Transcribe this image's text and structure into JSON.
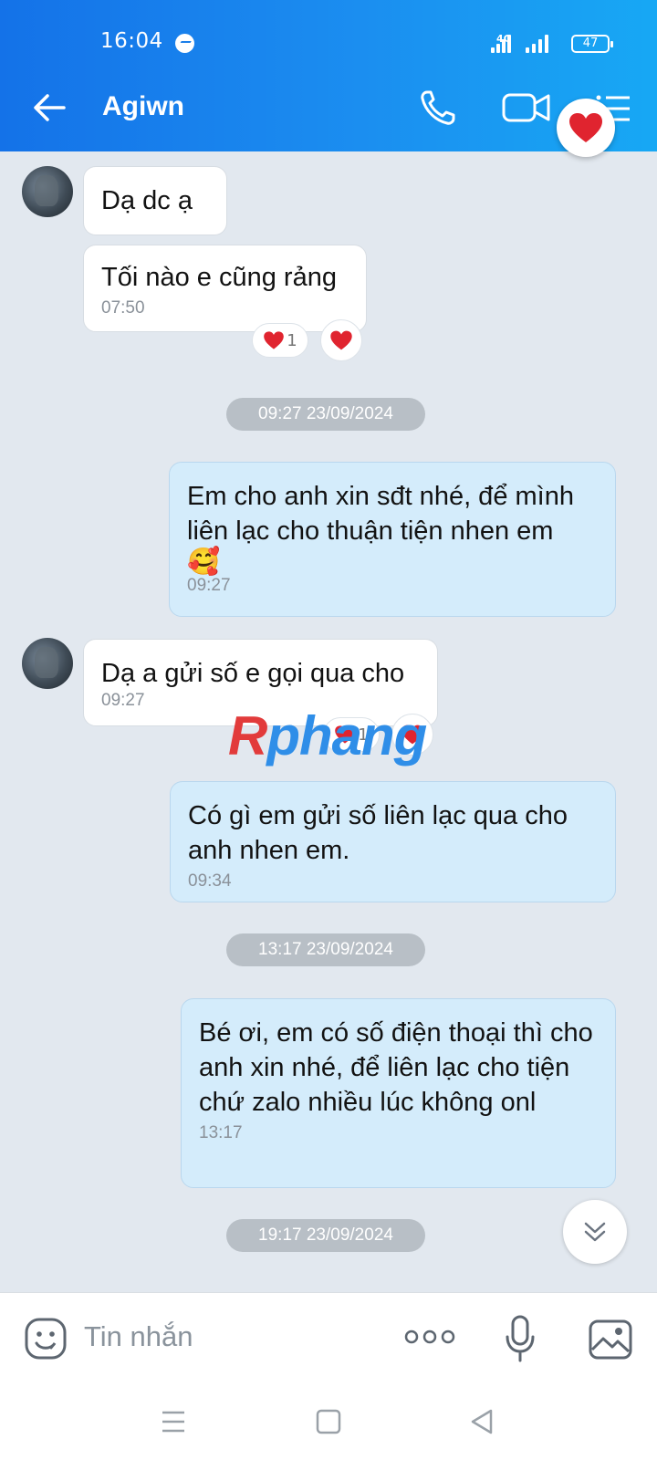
{
  "status": {
    "time": "16:04",
    "network": "4G",
    "battery": "47"
  },
  "header": {
    "title": "Agiwn"
  },
  "messages": {
    "m1": {
      "text": "Dạ dc ạ"
    },
    "m2": {
      "text": "Tối nào e cũng rảng",
      "time": "07:50",
      "reaction_count": "1"
    },
    "d1": "09:27 23/09/2024",
    "m3": {
      "text": "Em cho anh xin sđt nhé, để mình liên lạc cho thuận tiện nhen em",
      "emoji": "🥰",
      "time": "09:27"
    },
    "m4": {
      "text": "Dạ a gửi số e gọi qua cho",
      "time": "09:27",
      "reaction_count": "1"
    },
    "m5": {
      "text": "Có gì em gửi số liên lạc qua cho anh nhen em.",
      "time": "09:34"
    },
    "d2": "13:17 23/09/2024",
    "m6": {
      "text": "Bé ơi, em có số điện thoại thì cho anh xin nhé, để liên lạc cho tiện chứ zalo nhiều lúc không onl",
      "time": "13:17"
    },
    "d3": "19:17 23/09/2024"
  },
  "watermark": {
    "part1": "R",
    "part2": "phang"
  },
  "input": {
    "placeholder": "Tin nhắn"
  },
  "colors": {
    "header_start": "#1472e8",
    "header_end": "#17a8f4",
    "outgoing_bubble": "#d4ecfb",
    "incoming_bubble": "#ffffff",
    "heart": "#e0242f"
  },
  "icons": [
    "back-arrow-icon",
    "phone-icon",
    "video-camera-icon",
    "menu-icon",
    "heart-icon",
    "emoji-icon",
    "more-dots-icon",
    "microphone-icon",
    "image-icon",
    "chevron-double-down-icon"
  ]
}
